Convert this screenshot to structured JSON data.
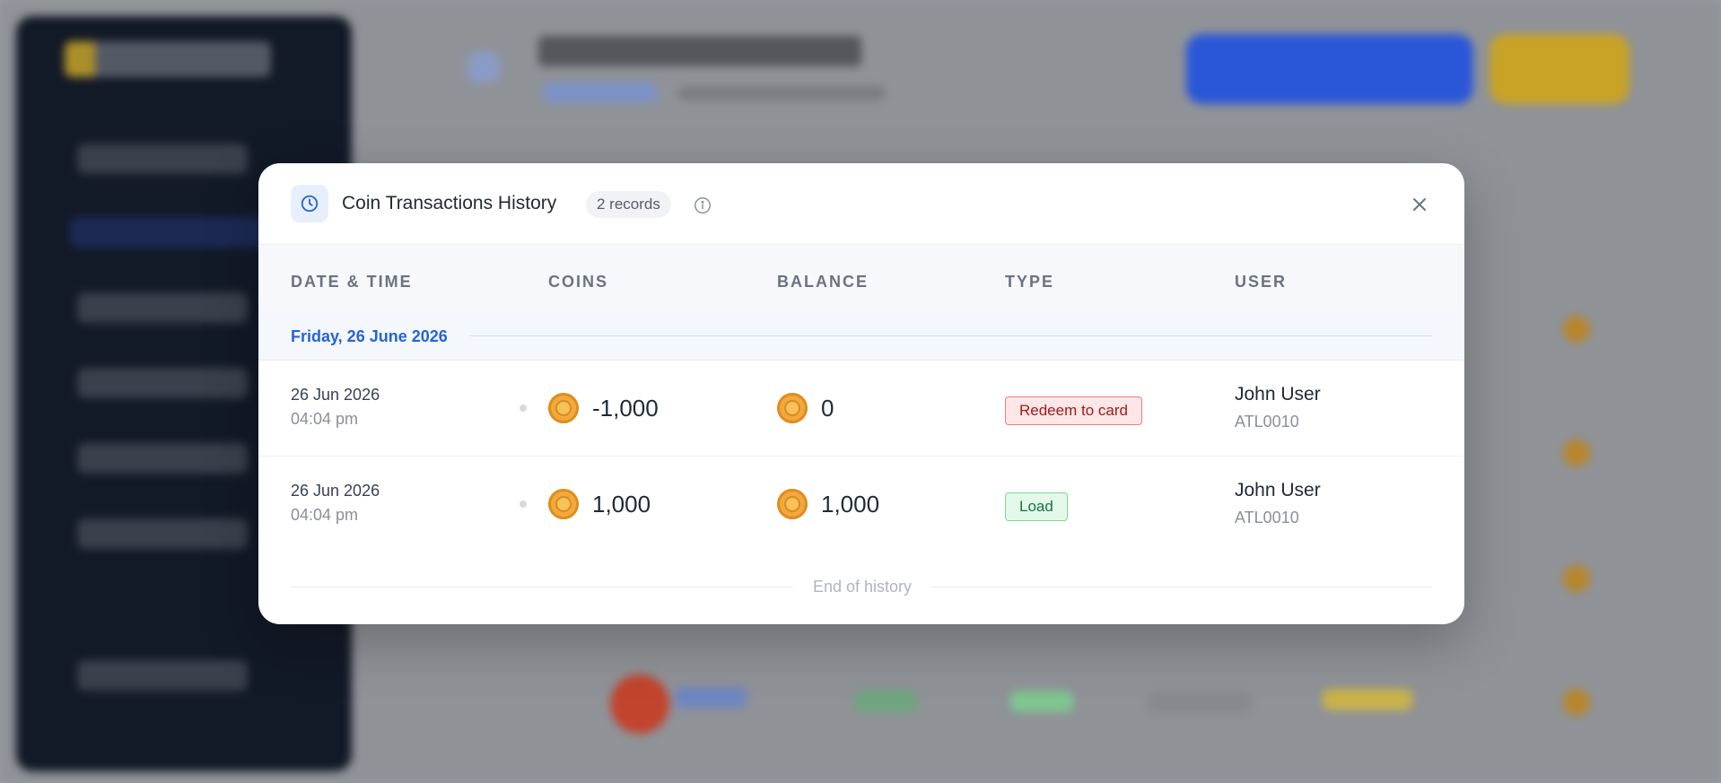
{
  "modal": {
    "title": "Coin Transactions History",
    "records_badge": "2 records",
    "columns": [
      "DATE & TIME",
      "COINS",
      "BALANCE",
      "TYPE",
      "USER"
    ],
    "group_label": "Friday, 26 June 2026",
    "rows": [
      {
        "date": "26 Jun 2026",
        "time": "04:04 pm",
        "coins": "-1,000",
        "balance": "0",
        "type": "Redeem to card",
        "type_color": "#a31a1a",
        "user_name": "John User",
        "user_id": "ATL0010"
      },
      {
        "date": "26 Jun 2026",
        "time": "04:04 pm",
        "coins": "1,000",
        "balance": "1,000",
        "type": "Load",
        "type_color": "#16733a",
        "user_name": "John User",
        "user_id": "ATL0010"
      }
    ],
    "end_text": "End of history",
    "accent": "#2563d9",
    "icons": {
      "header": "clock-icon",
      "info": "info-icon",
      "close": "close-icon",
      "coin": "coin-icon"
    }
  }
}
